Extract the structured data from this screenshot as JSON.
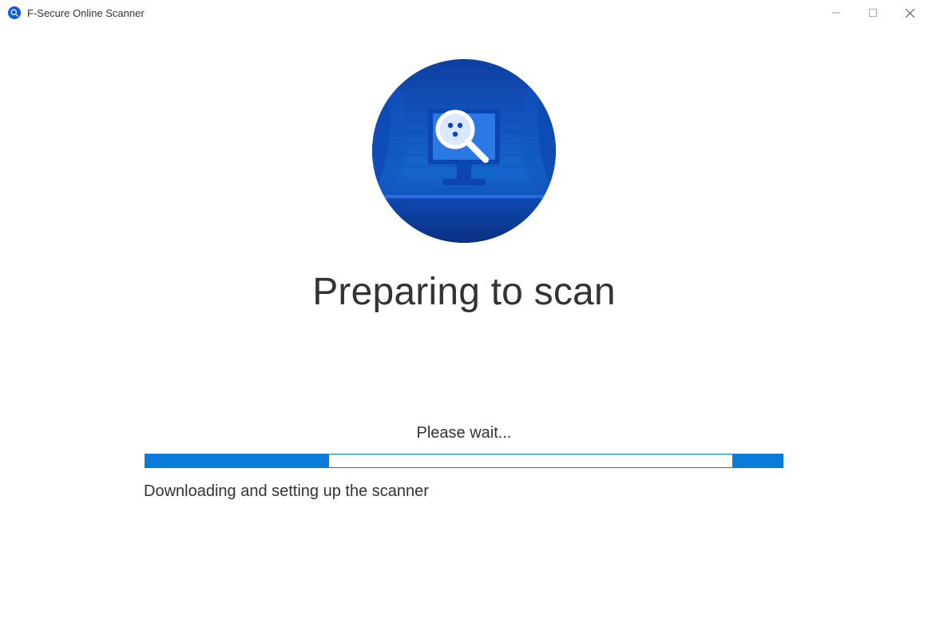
{
  "window": {
    "title": "F-Secure Online Scanner"
  },
  "main": {
    "heading": "Preparing to scan",
    "wait_text": "Please wait...",
    "status_text": "Downloading and setting up the scanner"
  },
  "colors": {
    "accent": "#0a7bd8"
  }
}
